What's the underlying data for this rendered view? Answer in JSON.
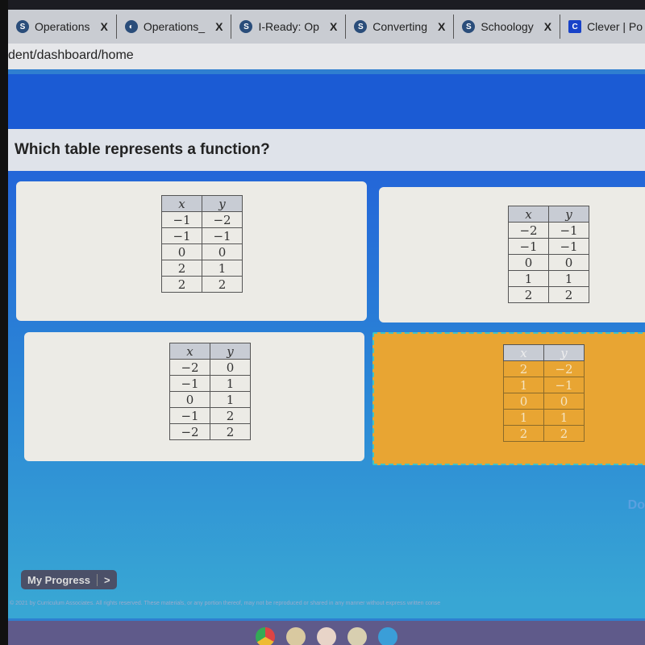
{
  "browser": {
    "tabs": [
      {
        "label": "Operations",
        "icon": "schoology-icon"
      },
      {
        "label": "Operations_",
        "icon": "globe-icon"
      },
      {
        "label": "I-Ready: Op",
        "icon": "schoology-icon"
      },
      {
        "label": "Converting",
        "icon": "schoology-icon"
      },
      {
        "label": "Schoology",
        "icon": "schoology-icon"
      },
      {
        "label": "Clever | Po",
        "icon": "clever-icon"
      }
    ],
    "close_label": "X",
    "address": "dent/dashboard/home"
  },
  "question": "Which table represents a function?",
  "options": [
    {
      "x": [
        "−1",
        "−1",
        "0",
        "2",
        "2"
      ],
      "y": [
        "−2",
        "−1",
        "0",
        "1",
        "2"
      ],
      "selected": false
    },
    {
      "x": [
        "−2",
        "−1",
        "0",
        "1",
        "2"
      ],
      "y": [
        "−1",
        "−1",
        "0",
        "1",
        "2"
      ],
      "selected": false
    },
    {
      "x": [
        "−2",
        "−1",
        "0",
        "−1",
        "−2"
      ],
      "y": [
        "0",
        "1",
        "1",
        "2",
        "2"
      ],
      "selected": false
    },
    {
      "x": [
        "2",
        "1",
        "0",
        "1",
        "2"
      ],
      "y": [
        "−2",
        "−1",
        "0",
        "1",
        "2"
      ],
      "selected": true
    }
  ],
  "headers": {
    "x": "x",
    "y": "y"
  },
  "done_label": "Do",
  "my_progress": "My Progress",
  "progress_arrow": ">",
  "footer": "© 2021 by Curriculum Associates. All rights reserved. These materials, or any portion thereof, may not be reproduced or shared in any manner without express written conse",
  "colors": {
    "header": "#1b5bd4",
    "selected": "#e8a533"
  }
}
